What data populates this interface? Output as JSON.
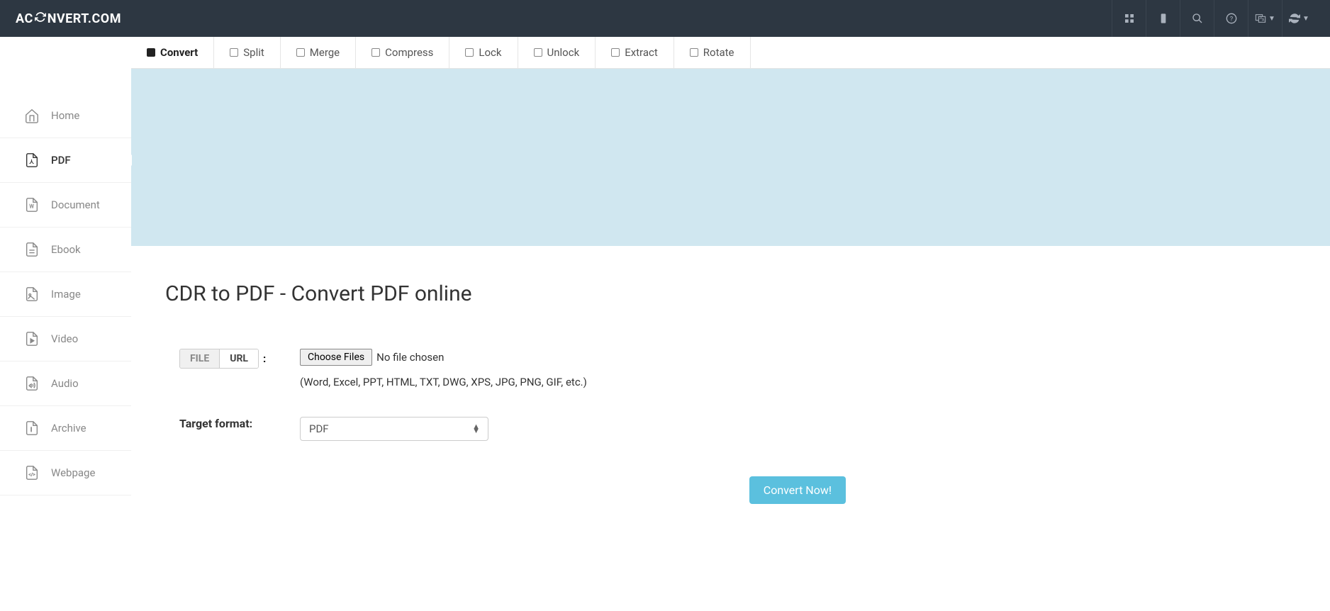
{
  "header": {
    "logo_part1": "AC",
    "logo_part2": "NVERT.COM"
  },
  "sidebar": {
    "items": [
      {
        "label": "Home"
      },
      {
        "label": "PDF"
      },
      {
        "label": "Document"
      },
      {
        "label": "Ebook"
      },
      {
        "label": "Image"
      },
      {
        "label": "Video"
      },
      {
        "label": "Audio"
      },
      {
        "label": "Archive"
      },
      {
        "label": "Webpage"
      }
    ]
  },
  "tabs": [
    {
      "label": "Convert"
    },
    {
      "label": "Split"
    },
    {
      "label": "Merge"
    },
    {
      "label": "Compress"
    },
    {
      "label": "Lock"
    },
    {
      "label": "Unlock"
    },
    {
      "label": "Extract"
    },
    {
      "label": "Rotate"
    }
  ],
  "main": {
    "title": "CDR to PDF - Convert PDF online",
    "source_toggle": {
      "file": "FILE",
      "url": "URL",
      "colon": ":"
    },
    "file_input": {
      "button": "Choose Files",
      "status": "No file chosen"
    },
    "hint": "(Word, Excel, PPT, HTML, TXT, DWG, XPS, JPG, PNG, GIF, etc.)",
    "target_label": "Target format:",
    "target_value": "PDF",
    "convert_button": "Convert Now!"
  }
}
